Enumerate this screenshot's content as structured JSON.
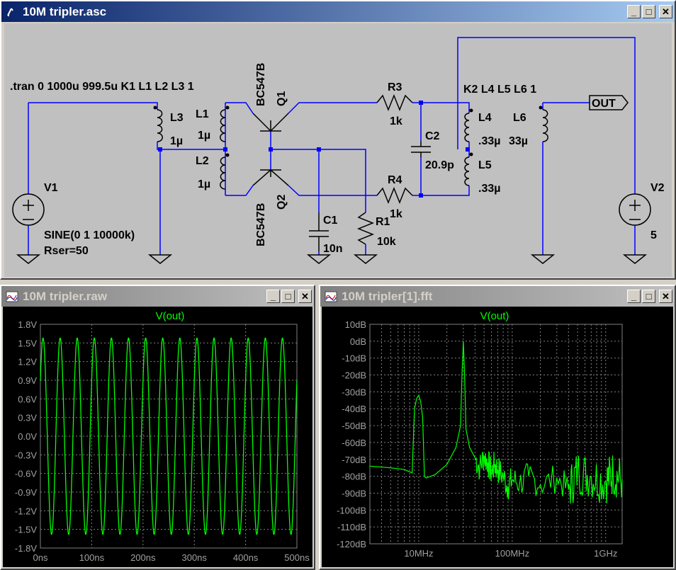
{
  "schematic": {
    "title": "10M tripler.asc",
    "directive_tran": ".tran 0 1000u 999.5u  K1 L1 L2 L3 1",
    "directive_k2": "K2 L4 L5 L6 1",
    "v1": {
      "name": "V1",
      "value_line1": "SINE(0 1 10000k)",
      "value_line2": "Rser=50"
    },
    "v2": {
      "name": "V2",
      "value": "5"
    },
    "q1": {
      "name": "Q1",
      "model": "BC547B"
    },
    "q2": {
      "name": "Q2",
      "model": "BC547B"
    },
    "l1": {
      "name": "L1",
      "value": "1µ"
    },
    "l2": {
      "name": "L2",
      "value": "1µ"
    },
    "l3": {
      "name": "L3",
      "value": "1µ"
    },
    "l4": {
      "name": "L4",
      "value": ".33µ"
    },
    "l5": {
      "name": "L5",
      "value": ".33µ"
    },
    "l6": {
      "name": "L6",
      "value": "33µ"
    },
    "r1": {
      "name": "R1",
      "value": "10k"
    },
    "r3": {
      "name": "R3",
      "value": "1k"
    },
    "r4": {
      "name": "R4",
      "value": "1k"
    },
    "c1": {
      "name": "C1",
      "value": "10n"
    },
    "c2": {
      "name": "C2",
      "value": "20.9p"
    },
    "out_label": "OUT"
  },
  "waveform": {
    "title": "10M tripler.raw",
    "trace_name": "V(out)",
    "y_ticks": [
      "1.8V",
      "1.5V",
      "1.2V",
      "0.9V",
      "0.6V",
      "0.3V",
      "0.0V",
      "-0.3V",
      "-0.6V",
      "-0.9V",
      "-1.2V",
      "-1.5V",
      "-1.8V"
    ],
    "x_ticks": [
      "0ns",
      "100ns",
      "200ns",
      "300ns",
      "400ns",
      "500ns"
    ]
  },
  "fft": {
    "title": "10M tripler[1].fft",
    "trace_name": "V(out)",
    "y_ticks": [
      "10dB",
      "0dB",
      "-10dB",
      "-20dB",
      "-30dB",
      "-40dB",
      "-50dB",
      "-60dB",
      "-70dB",
      "-80dB",
      "-90dB",
      "-100dB",
      "-110dB",
      "-120dB"
    ],
    "x_ticks": [
      "10MHz",
      "100MHz",
      "1GHz"
    ]
  },
  "colors": {
    "wire": "#0000ff",
    "trace": "#00ff00",
    "grid": "#808080",
    "background": "#000000",
    "schematic_bg": "#c0c0c0"
  },
  "chart_data": [
    {
      "type": "line",
      "title": "V(out)",
      "xlabel": "",
      "ylabel": "",
      "xlim": [
        0,
        500
      ],
      "ylim": [
        -1.8,
        1.8
      ],
      "x_unit": "ns",
      "y_unit": "V",
      "grid": true,
      "series": [
        {
          "name": "V(out)",
          "frequency_MHz": 30,
          "amplitude_V": 1.58
        }
      ]
    },
    {
      "type": "line",
      "title": "V(out)",
      "xlabel": "",
      "ylabel": "",
      "x_scale": "log",
      "xlim": [
        3,
        1500
      ],
      "ylim": [
        -120,
        10
      ],
      "x_unit": "MHz",
      "y_unit": "dB",
      "grid": true,
      "series": [
        {
          "name": "V(out)",
          "x": [
            3,
            5,
            7,
            8.5,
            9,
            9.5,
            10,
            10.5,
            11,
            11.5,
            12,
            15,
            20,
            25,
            28,
            29,
            30,
            31,
            32,
            35,
            40,
            45,
            50,
            55,
            60,
            65,
            70,
            80,
            90,
            100,
            120,
            150,
            200,
            300,
            400,
            500,
            700,
            1000,
            1200,
            1500
          ],
          "y": [
            -74,
            -75,
            -76,
            -78,
            -40,
            -34,
            -32,
            -36,
            -45,
            -80,
            -81,
            -79,
            -73,
            -63,
            -50,
            -20,
            0,
            -22,
            -52,
            -63,
            -69,
            -75,
            -68,
            -72,
            -78,
            -73,
            -76,
            -80,
            -86,
            -82,
            -84,
            -80,
            -85,
            -81,
            -88,
            -77,
            -80,
            -83,
            -78,
            -82
          ]
        }
      ]
    }
  ]
}
